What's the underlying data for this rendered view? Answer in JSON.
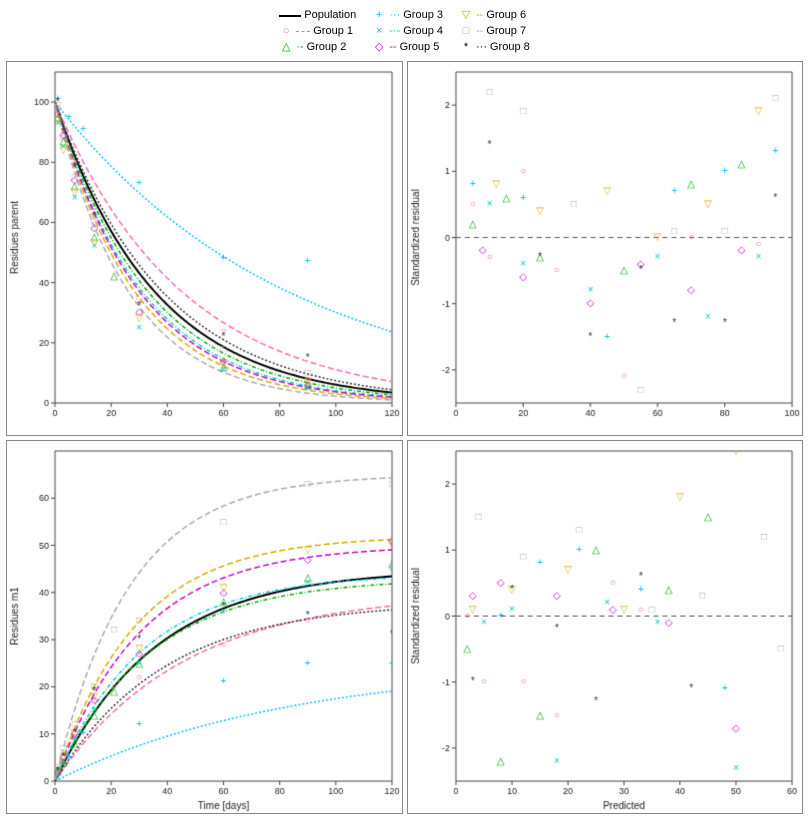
{
  "legend": {
    "items": [
      {
        "label": "Population",
        "type": "line",
        "color": "#000000",
        "dash": "solid",
        "symbol": ""
      },
      {
        "label": "Group 1",
        "type": "line",
        "color": "#ff69b4",
        "dash": "dashed",
        "symbol": "○"
      },
      {
        "label": "Group 2",
        "type": "line",
        "color": "#00aa00",
        "dash": "dashdot",
        "symbol": "△"
      },
      {
        "label": "Group 3",
        "type": "line",
        "color": "#00bfff",
        "dash": "dotted",
        "symbol": "+"
      },
      {
        "label": "Group 4",
        "type": "line",
        "color": "#00cccc",
        "dash": "dashdot",
        "symbol": "×"
      },
      {
        "label": "Group 5",
        "type": "line",
        "color": "#cc00cc",
        "dash": "dashed",
        "symbol": "◇"
      },
      {
        "label": "Group 6",
        "type": "line",
        "color": "#ddaa00",
        "dash": "dashed",
        "symbol": "▽"
      },
      {
        "label": "Group 7",
        "type": "line",
        "color": "#aaaaaa",
        "dash": "dashed",
        "symbol": "□"
      },
      {
        "label": "Group 8",
        "type": "line",
        "color": "#000000",
        "dash": "dotted",
        "symbol": "*"
      }
    ]
  },
  "plots": [
    {
      "id": "top-left",
      "ylabel": "Residues parent",
      "xlabel": "",
      "xrange": [
        0,
        120
      ],
      "yrange": [
        0,
        110
      ],
      "xticks": [
        0,
        20,
        40,
        60,
        80,
        100,
        120
      ],
      "yticks": [
        0,
        20,
        40,
        60,
        80,
        100
      ]
    },
    {
      "id": "top-right",
      "ylabel": "Standardized residual",
      "xlabel": "",
      "xrange": [
        0,
        100
      ],
      "yrange": [
        -2.5,
        2.5
      ],
      "xticks": [
        0,
        20,
        40,
        60,
        80,
        100
      ],
      "yticks": [
        -2,
        -1,
        0,
        1,
        2
      ]
    },
    {
      "id": "bottom-left",
      "ylabel": "Residues m1",
      "xlabel": "Time [days]",
      "xrange": [
        0,
        120
      ],
      "yrange": [
        0,
        70
      ],
      "xticks": [
        0,
        20,
        40,
        60,
        80,
        100,
        120
      ],
      "yticks": [
        0,
        10,
        20,
        30,
        40,
        50,
        60
      ]
    },
    {
      "id": "bottom-right",
      "ylabel": "Standardized residual",
      "xlabel": "Predicted",
      "xrange": [
        0,
        60
      ],
      "yrange": [
        -2.5,
        2.5
      ],
      "xticks": [
        0,
        10,
        20,
        30,
        40,
        50,
        60
      ],
      "yticks": [
        -2,
        -1,
        0,
        1,
        2
      ]
    }
  ]
}
